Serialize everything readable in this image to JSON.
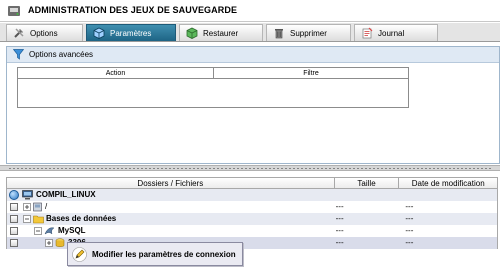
{
  "window": {
    "title": "ADMINISTRATION DES JEUX DE SAUVEGARDE"
  },
  "tabs": [
    {
      "label": "Options"
    },
    {
      "label": "Paramètres"
    },
    {
      "label": "Restaurer"
    },
    {
      "label": "Supprimer"
    },
    {
      "label": "Journal"
    }
  ],
  "options_panel": {
    "title": "Options avancées",
    "columns": [
      "Action",
      "Filtre"
    ]
  },
  "files": {
    "columns": [
      "Dossiers / Fichiers",
      "Taille",
      "Date de modification"
    ],
    "rows": [
      {
        "name": "COMPIL_LINUX",
        "size": "",
        "date": ""
      },
      {
        "name": "/",
        "size": "---",
        "date": "---"
      },
      {
        "name": "Bases de données",
        "size": "---",
        "date": "---"
      },
      {
        "name": "MySQL",
        "size": "---",
        "date": "---"
      },
      {
        "name": "3306",
        "size": "---",
        "date": "---"
      }
    ]
  },
  "tooltip": {
    "text": "Modifier les paramètres de connexion"
  }
}
